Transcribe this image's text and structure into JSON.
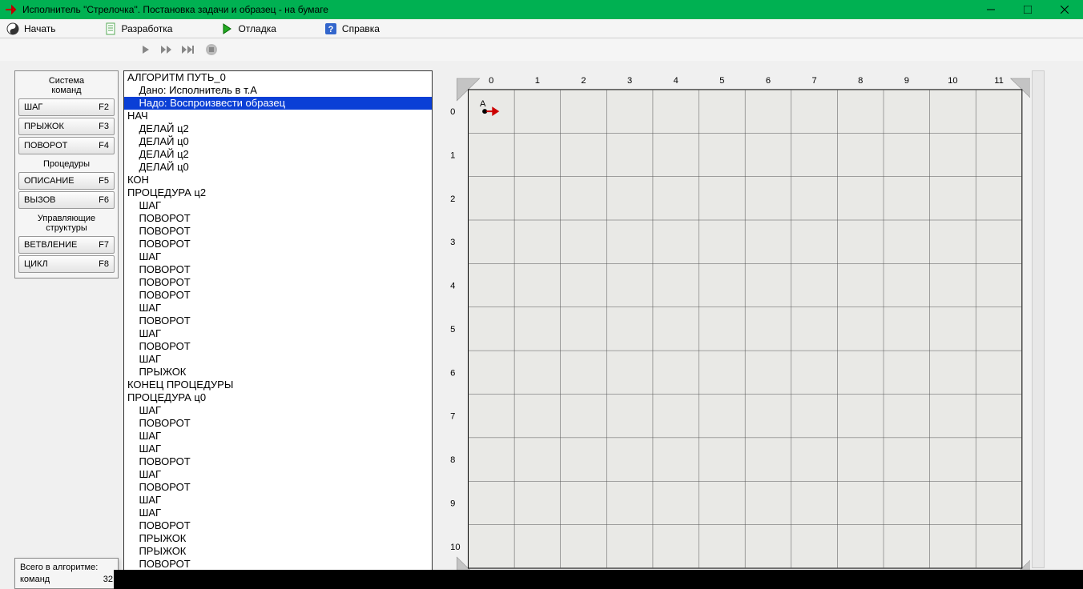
{
  "title": "Исполнитель \"Стрелочка\". Постановка задачи и образец - на бумаге",
  "toolbar": {
    "start": "Начать",
    "dev": "Разработка",
    "debug": "Отладка",
    "help": "Справка"
  },
  "sidebar": {
    "system_title": "Система\nкоманд",
    "buttons": [
      {
        "label": "ШАГ",
        "key": "F2"
      },
      {
        "label": "ПРЫЖОК",
        "key": "F3"
      },
      {
        "label": "ПОВОРОТ",
        "key": "F4"
      }
    ],
    "proc_title": "Процедуры",
    "proc_buttons": [
      {
        "label": "ОПИСАНИЕ",
        "key": "F5"
      },
      {
        "label": "ВЫЗОВ",
        "key": "F6"
      }
    ],
    "ctrl_title": "Управляющие\nструктуры",
    "ctrl_buttons": [
      {
        "label": "ВЕТВЛЕНИЕ",
        "key": "F7"
      },
      {
        "label": "ЦИКЛ",
        "key": "F8"
      }
    ]
  },
  "code": {
    "lines": [
      {
        "indent": 0,
        "text": "АЛГОРИТМ ПУТЬ_0"
      },
      {
        "indent": 1,
        "text": "Дано: Исполнитель в т.A"
      },
      {
        "indent": 1,
        "text": "Надо: Воспроизвести образец",
        "selected": true
      },
      {
        "indent": 0,
        "text": "НАЧ"
      },
      {
        "indent": 1,
        "text": "ДЕЛАЙ ц2"
      },
      {
        "indent": 1,
        "text": "ДЕЛАЙ ц0"
      },
      {
        "indent": 1,
        "text": "ДЕЛАЙ ц2"
      },
      {
        "indent": 1,
        "text": "ДЕЛАЙ ц0"
      },
      {
        "indent": 0,
        "text": "КОН"
      },
      {
        "indent": 0,
        "text": "ПРОЦЕДУРА ц2"
      },
      {
        "indent": 1,
        "text": "ШАГ"
      },
      {
        "indent": 1,
        "text": "ПОВОРОТ"
      },
      {
        "indent": 1,
        "text": "ПОВОРОТ"
      },
      {
        "indent": 1,
        "text": "ПОВОРОТ"
      },
      {
        "indent": 1,
        "text": "ШАГ"
      },
      {
        "indent": 1,
        "text": "ПОВОРОТ"
      },
      {
        "indent": 1,
        "text": "ПОВОРОТ"
      },
      {
        "indent": 1,
        "text": "ПОВОРОТ"
      },
      {
        "indent": 1,
        "text": "ШАГ"
      },
      {
        "indent": 1,
        "text": "ПОВОРОТ"
      },
      {
        "indent": 1,
        "text": "ШАГ"
      },
      {
        "indent": 1,
        "text": "ПОВОРОТ"
      },
      {
        "indent": 1,
        "text": "ШАГ"
      },
      {
        "indent": 1,
        "text": "ПРЫЖОК"
      },
      {
        "indent": 0,
        "text": "КОНЕЦ ПРОЦЕДУРЫ"
      },
      {
        "indent": 0,
        "text": "ПРОЦЕДУРА ц0"
      },
      {
        "indent": 1,
        "text": "ШАГ"
      },
      {
        "indent": 1,
        "text": "ПОВОРОТ"
      },
      {
        "indent": 1,
        "text": "ШАГ"
      },
      {
        "indent": 1,
        "text": "ШАГ"
      },
      {
        "indent": 1,
        "text": "ПОВОРОТ"
      },
      {
        "indent": 1,
        "text": "ШАГ"
      },
      {
        "indent": 1,
        "text": "ПОВОРОТ"
      },
      {
        "indent": 1,
        "text": "ШАГ"
      },
      {
        "indent": 1,
        "text": "ШАГ"
      },
      {
        "indent": 1,
        "text": "ПОВОРОТ"
      },
      {
        "indent": 1,
        "text": "ПРЫЖОК"
      },
      {
        "indent": 1,
        "text": "ПРЫЖОК"
      },
      {
        "indent": 1,
        "text": "ПОВОРОТ"
      }
    ]
  },
  "status": {
    "line1": "Всего в алгоритме:",
    "line2_left": "команд",
    "line2_right": "32"
  },
  "grid": {
    "cols": [
      "0",
      "1",
      "2",
      "3",
      "4",
      "5",
      "6",
      "7",
      "8",
      "9",
      "10",
      "11"
    ],
    "rows": [
      "0",
      "1",
      "2",
      "3",
      "4",
      "5",
      "6",
      "7",
      "8",
      "9",
      "10"
    ],
    "cursor_label": "A"
  }
}
